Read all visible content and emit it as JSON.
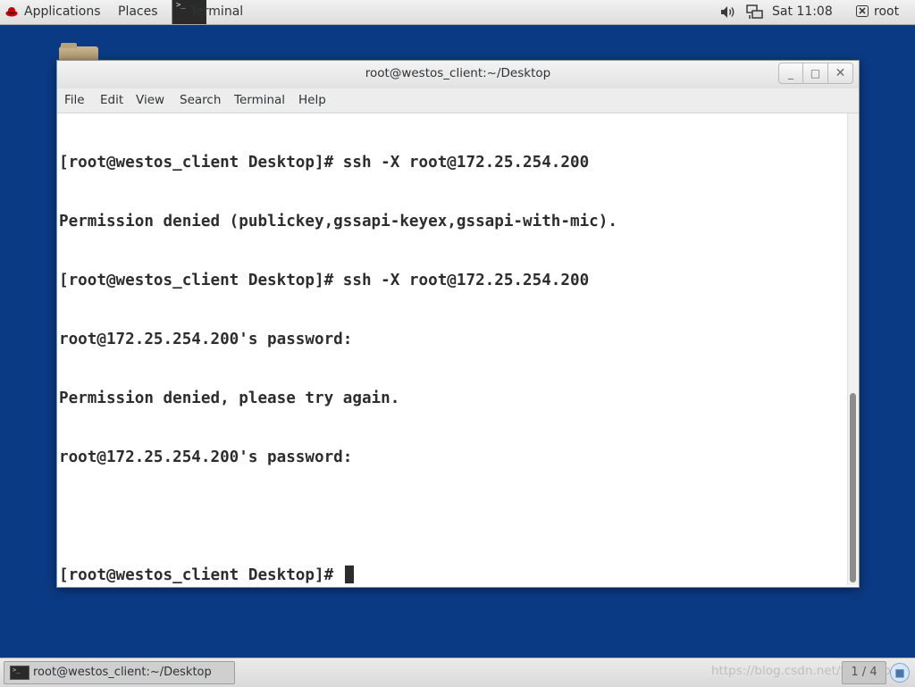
{
  "top_panel": {
    "applications": "Applications",
    "places": "Places",
    "active_app": "Terminal",
    "clock": "Sat 11:08",
    "user": "root"
  },
  "window": {
    "title": "root@westos_client:~/Desktop",
    "menu": [
      "File",
      "Edit",
      "View",
      "Search",
      "Terminal",
      "Help"
    ]
  },
  "terminal": {
    "lines": [
      "[root@westos_client Desktop]# ssh -X root@172.25.254.200",
      "Permission denied (publickey,gssapi-keyex,gssapi-with-mic).",
      "[root@westos_client Desktop]# ssh -X root@172.25.254.200",
      "root@172.25.254.200's password:",
      "Permission denied, please try again.",
      "root@172.25.254.200's password:",
      "",
      "[root@westos_client Desktop]# "
    ]
  },
  "taskbar": {
    "task_label": "root@westos_client:~/Desktop",
    "watermark": "https://blog.csdn.net/Snagerbr",
    "workspace": "1 / 4"
  },
  "colors": {
    "desktop_bg": "#0b3a84",
    "terminal_fg": "#2d2d2d",
    "terminal_bg": "#ffffff"
  },
  "icons": [
    "redhat-icon",
    "terminal-icon",
    "volume-icon",
    "network-icon",
    "user-icon",
    "minimize-icon",
    "maximize-icon",
    "close-icon"
  ]
}
